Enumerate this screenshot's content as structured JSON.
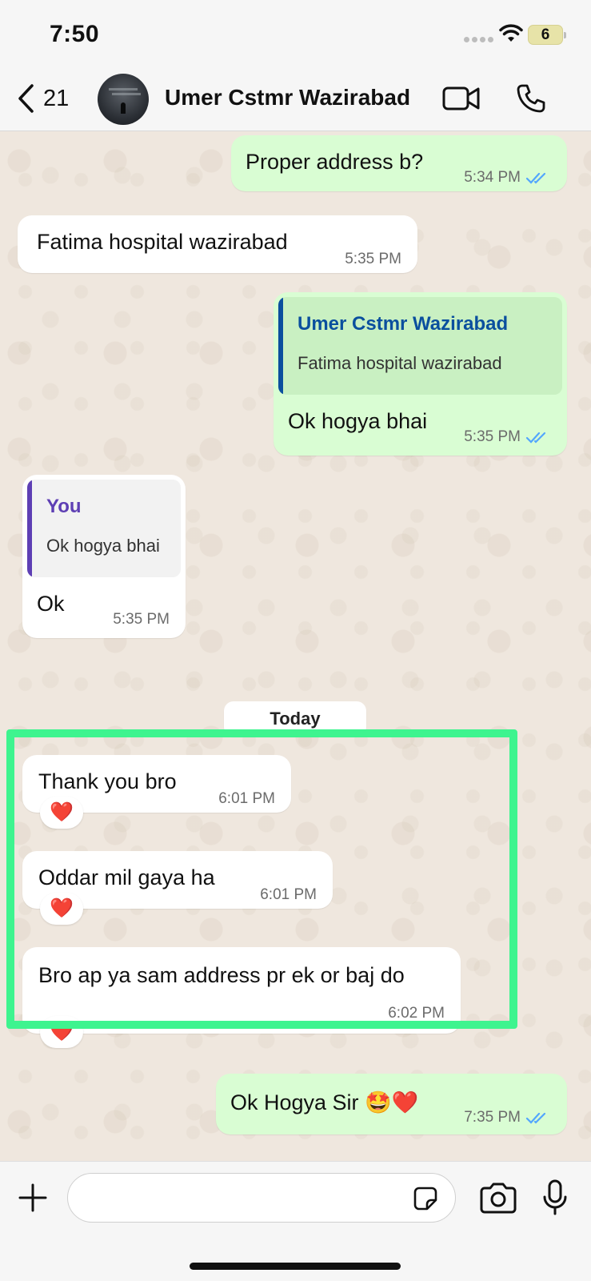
{
  "status_bar": {
    "time": "7:50",
    "battery": "6"
  },
  "header": {
    "back_count": "21",
    "contact_name": "Umer Cstmr Wazirabad"
  },
  "messages": [
    {
      "direction": "out",
      "text": "Proper address b?",
      "time": "5:34 PM",
      "read": true
    },
    {
      "direction": "in",
      "text": "Fatima hospital wazirabad",
      "time": "5:35 PM"
    },
    {
      "direction": "out",
      "quote": {
        "name": "Umer Cstmr Wazirabad",
        "text": "Fatima hospital wazirabad"
      },
      "text": "Ok hogya bhai",
      "time": "5:35 PM",
      "read": true
    },
    {
      "direction": "in",
      "quote": {
        "name": "You",
        "text": "Ok hogya bhai"
      },
      "text": "Ok",
      "time": "5:35 PM"
    },
    {
      "direction": "in",
      "text": "Thank you bro",
      "time": "6:01 PM",
      "reaction": "❤️"
    },
    {
      "direction": "in",
      "text": "Oddar mil gaya ha",
      "time": "6:01 PM",
      "reaction": "❤️"
    },
    {
      "direction": "in",
      "text": "Bro ap ya sam address pr ek or baj do",
      "time": "6:02 PM",
      "reaction": "❤️"
    },
    {
      "direction": "out",
      "text": "Ok Hogya Sir 🤩❤️",
      "time": "7:35 PM",
      "read": true
    }
  ],
  "day_separator": "Today",
  "input": {
    "value": "",
    "placeholder": ""
  },
  "colors": {
    "outgoing_bubble": "#d9fdd3",
    "incoming_bubble": "#ffffff",
    "read_ticks": "#53a6fd",
    "highlight": "#3ef48f",
    "quote_out_accent": "#0a4f9e",
    "quote_in_accent": "#5e3fb4"
  },
  "icons": [
    "back-chevron-icon",
    "wifi-icon",
    "video-camera-icon",
    "phone-icon",
    "plus-icon",
    "sticker-icon",
    "camera-icon",
    "microphone-icon",
    "double-check-icon"
  ]
}
